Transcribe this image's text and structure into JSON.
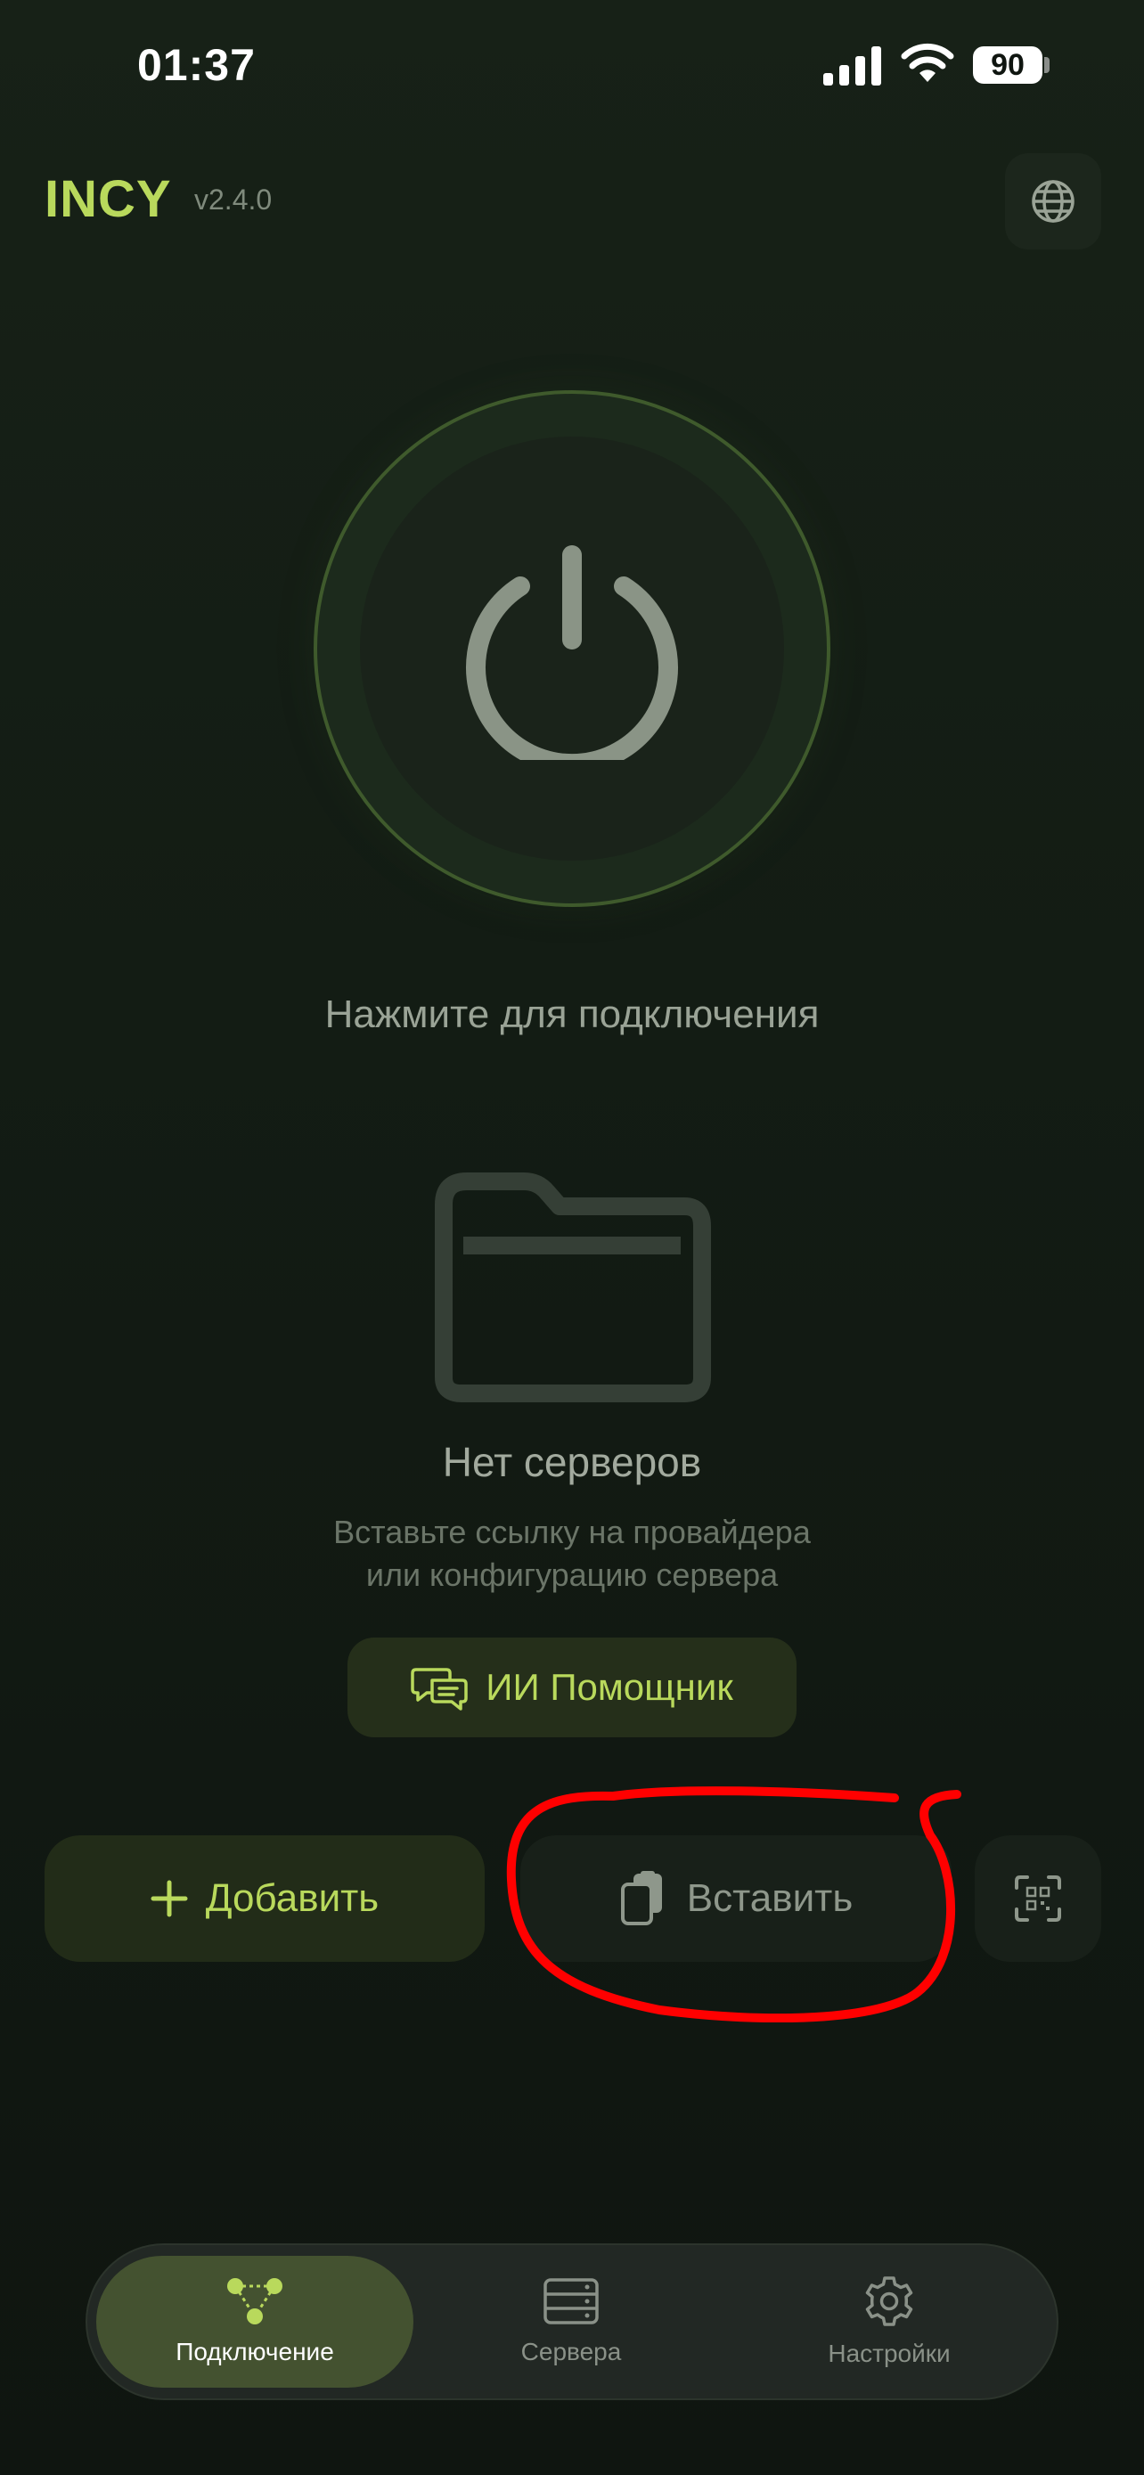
{
  "status_bar": {
    "time": "01:37",
    "battery_level": "90",
    "icons": [
      "signal-icon",
      "wifi-icon",
      "battery-icon"
    ]
  },
  "header": {
    "brand": "INCY",
    "version": "v2.4.0",
    "language_icon": "globe-icon"
  },
  "power": {
    "icon": "power-icon",
    "hint": "Нажмите для подключения"
  },
  "empty_state": {
    "icon": "folder-icon",
    "title": "Нет серверов",
    "subtitle_line1": "Вставьте ссылку на провайдера",
    "subtitle_line2": "или конфигурацию сервера",
    "ai_button": {
      "icon": "chat-bubbles-icon",
      "label": "ИИ Помощник"
    }
  },
  "actions": {
    "add": {
      "icon": "plus-icon",
      "label": "Добавить"
    },
    "paste": {
      "icon": "clipboard-icon",
      "label": "Вставить"
    },
    "scan": {
      "icon": "qr-scan-icon"
    }
  },
  "nav": {
    "items": [
      {
        "label": "Подключение",
        "icon": "connection-nodes-icon",
        "active": true
      },
      {
        "label": "Сервера",
        "icon": "server-rack-icon",
        "active": false
      },
      {
        "label": "Настройки",
        "icon": "gear-icon",
        "active": false
      }
    ]
  },
  "colors": {
    "accent": "#b9d95c",
    "background": "#131c14",
    "annotation": "#ff0000"
  }
}
